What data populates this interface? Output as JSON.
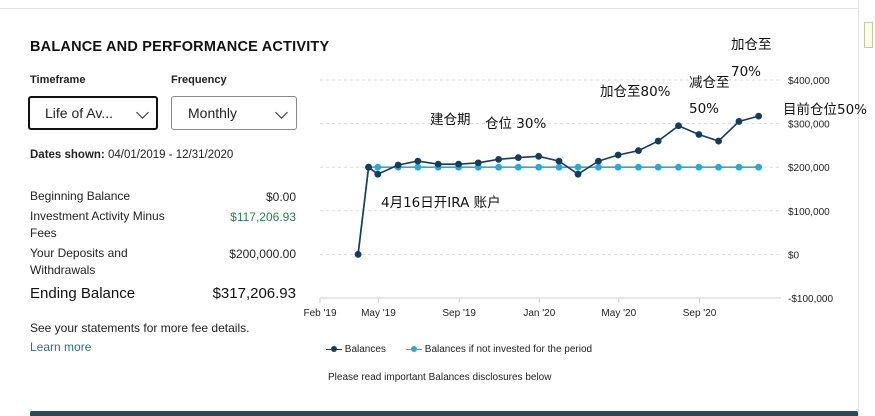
{
  "section": {
    "title": "BALANCE AND PERFORMANCE ACTIVITY"
  },
  "controls": {
    "timeframe_label": "Timeframe",
    "timeframe_value": "Life of Av...",
    "frequency_label": "Frequency",
    "frequency_value": "Monthly"
  },
  "dates": {
    "label": "Dates shown:",
    "value": "04/01/2019 - 12/31/2020"
  },
  "summary": {
    "rows": [
      {
        "label": "Beginning Balance",
        "value": "$0.00"
      },
      {
        "label": "Investment Activity Minus Fees",
        "value": "$117,206.93"
      },
      {
        "label": "Your Deposits and Withdrawals",
        "value": "$200,000.00"
      }
    ],
    "ending_label": "Ending Balance",
    "ending_value": "$317,206.93"
  },
  "notes": {
    "fee_note": "See your statements for more fee details.",
    "learn_more": "Learn more"
  },
  "legend": {
    "balances": "Balances",
    "not_invested": "Balances if not invested for the period"
  },
  "disclosure": "Please read important Balances disclosures below",
  "colors": {
    "balances": "#143d5c",
    "not_invested": "#29a9d6",
    "green_value": "#2e7d4f",
    "link": "#2f6f86"
  },
  "annotations": {
    "build_period": "建仓期",
    "position_30": "仓位 30%",
    "ira_open": "4月16日开IRA 账户",
    "add_to_80": "加仓至80%",
    "reduce_to_50_a": "减仓至",
    "reduce_to_50_b": "50%",
    "add_to_70_a": "加仓至",
    "add_to_70_b": "70%",
    "current_50": "目前仓位50%"
  },
  "chart_data": {
    "type": "line",
    "x": [
      "2019-03-31",
      "2019-04-16",
      "2019-04-30",
      "2019-05-31",
      "2019-06-30",
      "2019-07-31",
      "2019-08-31",
      "2019-09-30",
      "2019-10-31",
      "2019-11-30",
      "2019-12-31",
      "2020-01-31",
      "2020-02-29",
      "2020-03-31",
      "2020-04-30",
      "2020-05-31",
      "2020-06-30",
      "2020-07-31",
      "2020-08-31",
      "2020-09-30",
      "2020-10-31",
      "2020-11-30",
      "2020-12-31"
    ],
    "series": [
      {
        "name": "Balances",
        "values": [
          0,
          200000,
          184000,
          205000,
          214000,
          207000,
          207000,
          210000,
          218000,
          222000,
          225000,
          214000,
          184000,
          214000,
          228000,
          238000,
          260000,
          295000,
          275000,
          260000,
          305000,
          317207,
          null
        ]
      },
      {
        "name": "Balances if not invested for the period",
        "values": [
          0,
          200000,
          200000,
          200000,
          200000,
          200000,
          200000,
          200000,
          200000,
          200000,
          200000,
          200000,
          200000,
          200000,
          200000,
          200000,
          200000,
          200000,
          200000,
          200000,
          200000,
          200000,
          null
        ]
      }
    ],
    "x_ticks": [
      "Feb '19",
      "May '19",
      "Sep '19",
      "Jan '20",
      "May '20",
      "Sep '20"
    ],
    "y_ticks": [
      "$400,000",
      "$300,000",
      "$200,000",
      "$100,000",
      "$0",
      "-$100,000"
    ],
    "ylim": [
      -100000,
      400000
    ],
    "legend_position": "bottom"
  }
}
